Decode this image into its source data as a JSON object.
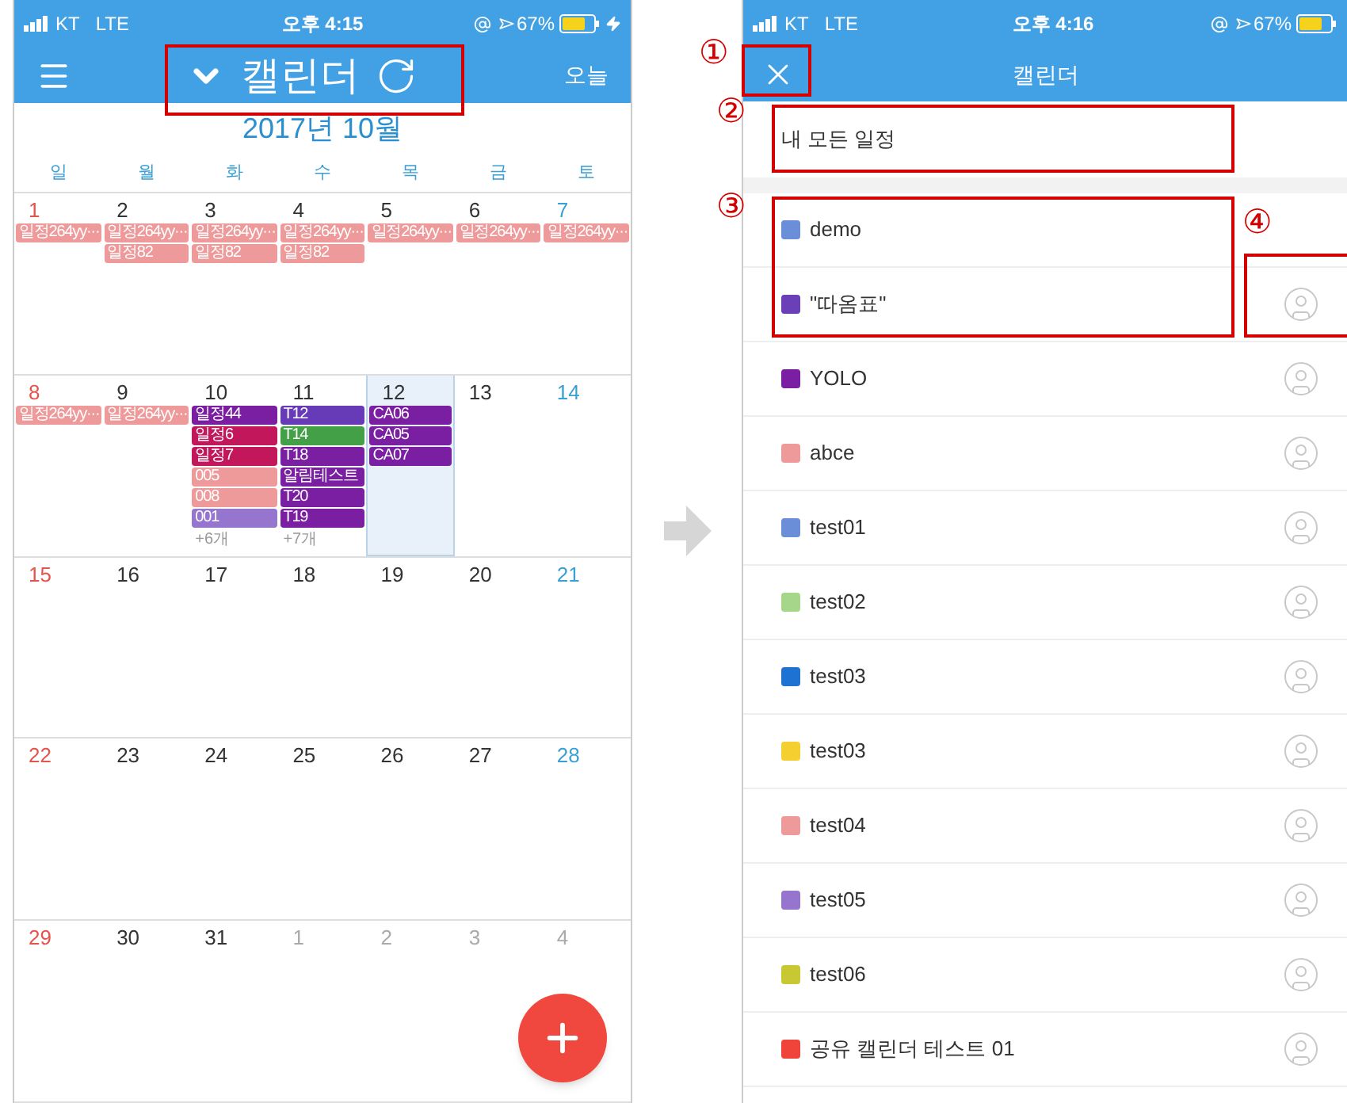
{
  "left": {
    "status": {
      "carrier": "KT",
      "network": "LTE",
      "time": "오후 4:15",
      "battery": "67%"
    },
    "header": {
      "title": "캘린더",
      "today": "오늘"
    },
    "month": "2017년 10월",
    "weekdays": [
      "일",
      "월",
      "화",
      "수",
      "목",
      "금",
      "토"
    ],
    "weeks": [
      {
        "days": [
          {
            "date": "1",
            "kind": "sun",
            "selected": false,
            "events": [
              {
                "label": "일정264yy···",
                "color": "#ef9a9a"
              }
            ]
          },
          {
            "date": "2",
            "kind": "weekday",
            "selected": false,
            "events": [
              {
                "label": "일정264yy···",
                "color": "#ef9a9a"
              },
              {
                "label": "일정82",
                "color": "#ef9a9a"
              }
            ]
          },
          {
            "date": "3",
            "kind": "weekday",
            "selected": false,
            "events": [
              {
                "label": "일정264yy···",
                "color": "#ef9a9a"
              },
              {
                "label": "일정82",
                "color": "#ef9a9a"
              }
            ]
          },
          {
            "date": "4",
            "kind": "weekday",
            "selected": false,
            "events": [
              {
                "label": "일정264yy···",
                "color": "#ef9a9a"
              },
              {
                "label": "일정82",
                "color": "#ef9a9a"
              }
            ]
          },
          {
            "date": "5",
            "kind": "weekday",
            "selected": false,
            "events": [
              {
                "label": "일정264yy···",
                "color": "#ef9a9a"
              }
            ]
          },
          {
            "date": "6",
            "kind": "weekday",
            "selected": false,
            "events": [
              {
                "label": "일정264yy···",
                "color": "#ef9a9a"
              }
            ]
          },
          {
            "date": "7",
            "kind": "sat",
            "selected": false,
            "events": [
              {
                "label": "일정264yy···",
                "color": "#ef9a9a"
              }
            ]
          }
        ]
      },
      {
        "days": [
          {
            "date": "8",
            "kind": "sun",
            "selected": false,
            "events": [
              {
                "label": "일정264yy···",
                "color": "#ef9a9a"
              }
            ]
          },
          {
            "date": "9",
            "kind": "weekday",
            "selected": false,
            "events": [
              {
                "label": "일정264yy···",
                "color": "#ef9a9a"
              }
            ]
          },
          {
            "date": "10",
            "kind": "weekday",
            "selected": false,
            "events": [
              {
                "label": "일정44",
                "color": "#7b1fa2"
              },
              {
                "label": "일정6",
                "color": "#c2185b"
              },
              {
                "label": "일정7",
                "color": "#c2185b"
              },
              {
                "label": "005",
                "color": "#ef9a9a"
              },
              {
                "label": "008",
                "color": "#ef9a9a"
              },
              {
                "label": "001",
                "color": "#9575cd"
              }
            ],
            "more": "+6개"
          },
          {
            "date": "11",
            "kind": "weekday",
            "selected": false,
            "events": [
              {
                "label": "T12",
                "color": "#673ab7"
              },
              {
                "label": "T14",
                "color": "#43a047"
              },
              {
                "label": "T18",
                "color": "#7b1fa2"
              },
              {
                "label": "알림테스트",
                "color": "#7b1fa2"
              },
              {
                "label": "T20",
                "color": "#7b1fa2"
              },
              {
                "label": "T19",
                "color": "#7b1fa2"
              }
            ],
            "more": "+7개"
          },
          {
            "date": "12",
            "kind": "weekday",
            "selected": true,
            "events": [
              {
                "label": "CA06",
                "color": "#7b1fa2"
              },
              {
                "label": "CA05",
                "color": "#7b1fa2"
              },
              {
                "label": "CA07",
                "color": "#7b1fa2"
              }
            ]
          },
          {
            "date": "13",
            "kind": "weekday",
            "selected": false
          },
          {
            "date": "14",
            "kind": "sat",
            "selected": false
          }
        ]
      },
      {
        "days": [
          {
            "date": "15",
            "kind": "sun",
            "selected": false
          },
          {
            "date": "16",
            "kind": "weekday",
            "selected": false
          },
          {
            "date": "17",
            "kind": "weekday",
            "selected": false
          },
          {
            "date": "18",
            "kind": "weekday",
            "selected": false
          },
          {
            "date": "19",
            "kind": "weekday",
            "selected": false
          },
          {
            "date": "20",
            "kind": "weekday",
            "selected": false
          },
          {
            "date": "21",
            "kind": "sat",
            "selected": false
          }
        ]
      },
      {
        "days": [
          {
            "date": "22",
            "kind": "sun",
            "selected": false
          },
          {
            "date": "23",
            "kind": "weekday",
            "selected": false
          },
          {
            "date": "24",
            "kind": "weekday",
            "selected": false
          },
          {
            "date": "25",
            "kind": "weekday",
            "selected": false
          },
          {
            "date": "26",
            "kind": "weekday",
            "selected": false
          },
          {
            "date": "27",
            "kind": "weekday",
            "selected": false
          },
          {
            "date": "28",
            "kind": "sat",
            "selected": false
          }
        ]
      },
      {
        "days": [
          {
            "date": "29",
            "kind": "sun",
            "selected": false
          },
          {
            "date": "30",
            "kind": "weekday",
            "selected": false
          },
          {
            "date": "31",
            "kind": "weekday",
            "selected": false
          },
          {
            "date": "1",
            "kind": "other",
            "selected": false
          },
          {
            "date": "2",
            "kind": "other",
            "selected": false
          },
          {
            "date": "3",
            "kind": "other",
            "selected": false
          },
          {
            "date": "4",
            "kind": "other",
            "selected": false
          }
        ]
      }
    ]
  },
  "right": {
    "status": {
      "carrier": "KT",
      "network": "LTE",
      "time": "오후 4:16",
      "battery": "67%"
    },
    "header": {
      "title": "캘린더"
    },
    "all_label": "내 모든 일정",
    "calendars": [
      {
        "name": "demo",
        "color": "#6a8fd8",
        "shared": false
      },
      {
        "name": "\"따옴표\"",
        "color": "#6a3fb8",
        "shared": true
      },
      {
        "name": "YOLO",
        "color": "#7b1fa2",
        "shared": true
      },
      {
        "name": "abce",
        "color": "#ef9a9a",
        "shared": true
      },
      {
        "name": "test01",
        "color": "#6a8fd8",
        "shared": true
      },
      {
        "name": "test02",
        "color": "#a5d68a",
        "shared": true
      },
      {
        "name": "test03",
        "color": "#1e73d2",
        "shared": true
      },
      {
        "name": "test03",
        "color": "#f5cf30",
        "shared": true
      },
      {
        "name": "test04",
        "color": "#ef9a9a",
        "shared": true
      },
      {
        "name": "test05",
        "color": "#9575cd",
        "shared": true
      },
      {
        "name": "test06",
        "color": "#c8c832",
        "shared": true
      },
      {
        "name": "공유 캘린더 테스트 01",
        "color": "#f0443a",
        "shared": true
      }
    ]
  },
  "annotations": [
    "①",
    "②",
    "③",
    "④"
  ]
}
